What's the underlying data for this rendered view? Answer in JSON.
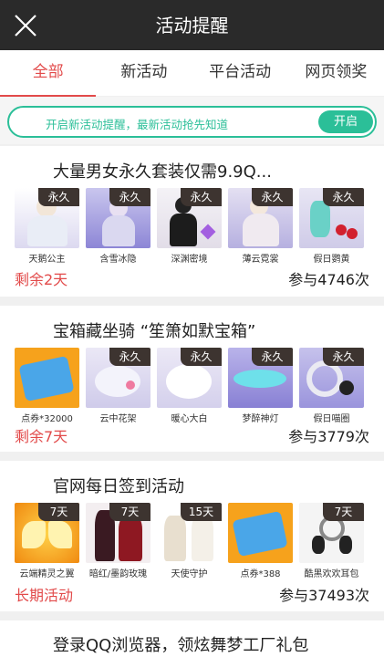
{
  "header": {
    "title": "活动提醒",
    "close_icon": "close-icon"
  },
  "tabs": [
    {
      "label": "全部",
      "active": true
    },
    {
      "label": "新活动",
      "active": false
    },
    {
      "label": "平台活动",
      "active": false
    },
    {
      "label": "网页领奖",
      "active": false
    }
  ],
  "notice": {
    "text": "开启新活动提醒，最新活动抢先知道",
    "button": "开启"
  },
  "activities": [
    {
      "title": "大量男女永久套装仅需9.9Q...",
      "items": [
        {
          "badge": "永久",
          "name": "天鹅公主"
        },
        {
          "badge": "永久",
          "name": "含雪冰隐"
        },
        {
          "badge": "永久",
          "name": "深渊密境"
        },
        {
          "badge": "永久",
          "name": "薄云霓裳"
        },
        {
          "badge": "永久",
          "name": "假日鹦黄"
        }
      ],
      "remaining": "剩余2天",
      "participants": "参与4746次"
    },
    {
      "title": "宝箱藏坐骑 “笙箫如默宝箱”",
      "items": [
        {
          "badge": "",
          "name": "点券*32000"
        },
        {
          "badge": "永久",
          "name": "云中花架"
        },
        {
          "badge": "永久",
          "name": "暖心大白"
        },
        {
          "badge": "永久",
          "name": "梦醉神灯"
        },
        {
          "badge": "永久",
          "name": "假日喵圈"
        }
      ],
      "remaining": "剩余7天",
      "participants": "参与3779次"
    },
    {
      "title": "官网每日签到活动",
      "items": [
        {
          "badge": "7天",
          "name": "云端精灵之翼"
        },
        {
          "badge": "7天",
          "name": "暗红/墨韵玫瑰"
        },
        {
          "badge": "15天",
          "name": "天使守护"
        },
        {
          "badge": "",
          "name": "点券*388"
        },
        {
          "badge": "7天",
          "name": "酷黑欢欢耳包"
        }
      ],
      "remaining": "长期活动",
      "participants": "参与37493次"
    },
    {
      "title": "登录QQ浏览器，领炫舞梦工厂礼包",
      "items": [],
      "remaining": "",
      "participants": ""
    }
  ],
  "colors": {
    "accent_red": "#e24a4a",
    "accent_green": "#2bbf98",
    "header_bg": "#2a2a2a"
  }
}
